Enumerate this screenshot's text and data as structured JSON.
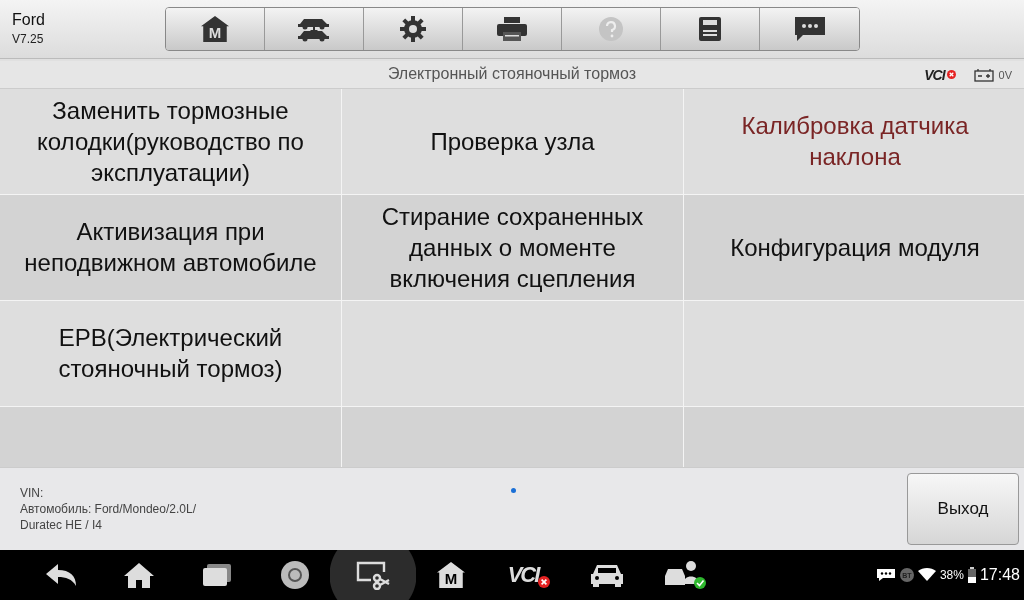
{
  "header": {
    "make": "Ford",
    "version": "V7.25"
  },
  "toolbar": [
    {
      "kind": "home",
      "glyph": "M"
    },
    {
      "kind": "cars"
    },
    {
      "kind": "settings"
    },
    {
      "kind": "print"
    },
    {
      "kind": "help",
      "disabled": true
    },
    {
      "kind": "save"
    },
    {
      "kind": "chat"
    }
  ],
  "title_bar": {
    "title": "Электронный стояночный тормоз",
    "vci": "VCI",
    "vci_connected": false,
    "voltage": "0V"
  },
  "menu": [
    {
      "label": "Заменить тормозные колодки(руководство по эксплуатации)",
      "highlighted": false
    },
    {
      "label": "Проверка узла",
      "highlighted": false
    },
    {
      "label": "Калибровка датчика наклона",
      "highlighted": true
    },
    {
      "label": "Активизация при неподвижном автомобиле",
      "highlighted": false
    },
    {
      "label": "Стирание сохраненных данных о моменте включения сцепления",
      "highlighted": false
    },
    {
      "label": "Конфигурация модуля",
      "highlighted": false
    },
    {
      "label": "EPB(Электрический стояночный тормоз)",
      "highlighted": false
    }
  ],
  "footer": {
    "vin": "VIN:",
    "vehicle_lines": [
      "Автомобиль: Ford/Mondeo/2.0L/",
      "Duratec HE / I4"
    ],
    "exit_button": "Выход"
  },
  "nav_bar": [
    {
      "kind": "back"
    },
    {
      "kind": "home"
    },
    {
      "kind": "recents"
    },
    {
      "kind": "browser"
    },
    {
      "kind": "screenshot",
      "selected": true
    },
    {
      "kind": "m-home",
      "glyph": "M"
    },
    {
      "kind": "vci",
      "glyph": "VCI"
    },
    {
      "kind": "car"
    },
    {
      "kind": "service"
    }
  ],
  "status": {
    "bt": "BT",
    "battery": "38%",
    "time": "17:48"
  }
}
